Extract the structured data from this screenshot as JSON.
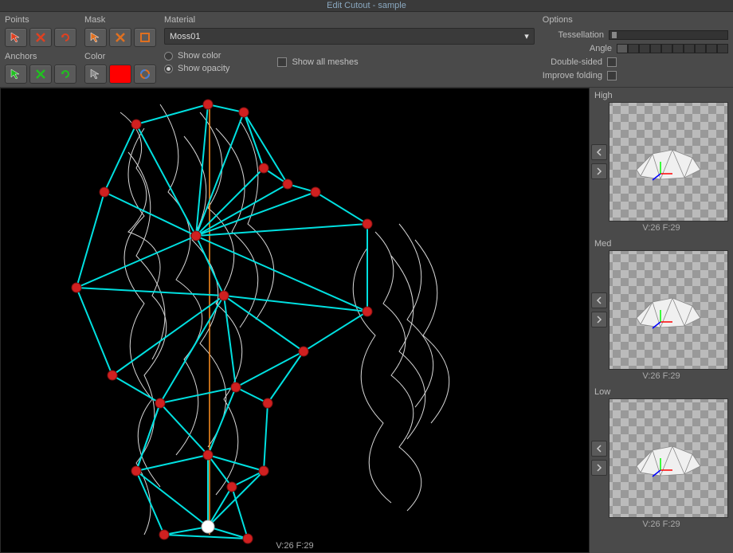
{
  "title": "Edit Cutout - sample",
  "groups": {
    "points": "Points",
    "anchors": "Anchors",
    "mask": "Mask",
    "color": "Color",
    "material": "Material",
    "options": "Options"
  },
  "material": {
    "selected": "Moss01",
    "show_color": "Show color",
    "show_opacity": "Show opacity",
    "show_all_meshes": "Show all  meshes"
  },
  "options": {
    "tessellation": "Tessellation",
    "angle": "Angle",
    "double_sided": "Double-sided",
    "improve_folding": "Improve folding"
  },
  "viewport": {
    "stats": "V:26  F:29"
  },
  "lod": {
    "levels": [
      {
        "label": "High",
        "stats": "V:26  F:29"
      },
      {
        "label": "Med",
        "stats": "V:26  F:29"
      },
      {
        "label": "Low",
        "stats": "V:26  F:29"
      }
    ]
  }
}
